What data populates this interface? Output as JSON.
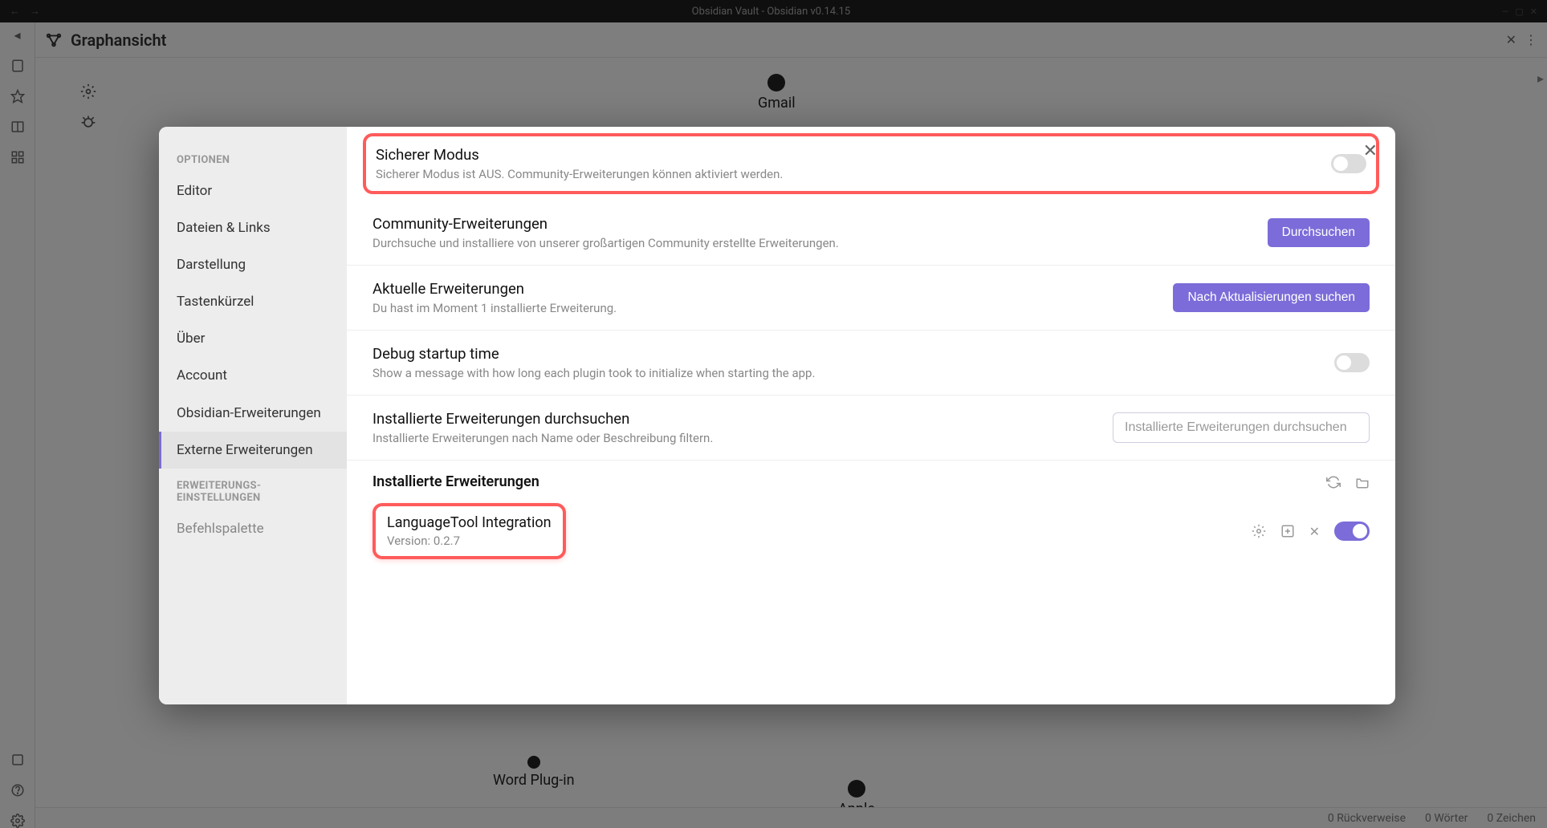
{
  "window": {
    "title": "Obsidian Vault - Obsidian v0.14.15"
  },
  "tab": {
    "title": "Graphansicht"
  },
  "graph": {
    "nodes": {
      "gmail": "Gmail",
      "wordplugin": "Word Plug-in",
      "apple": "Apple"
    }
  },
  "statusbar": {
    "backlinks": "0 Rückverweise",
    "words": "0 Wörter",
    "chars": "0 Zeichen"
  },
  "settings": {
    "sections": {
      "options": "OPTIONEN",
      "pluginSettings": "ERWEITERUNGS-EINSTELLUNGEN"
    },
    "items": {
      "editor": "Editor",
      "filesLinks": "Dateien & Links",
      "appearance": "Darstellung",
      "hotkeys": "Tastenkürzel",
      "about": "Über",
      "account": "Account",
      "corePlugins": "Obsidian-Erweiterungen",
      "communityPlugins": "Externe Erweiterungen",
      "befehlspalette": "Befehlspalette"
    },
    "safeMode": {
      "title": "Sicherer Modus",
      "desc": "Sicherer Modus ist AUS. Community-Erweiterungen können aktiviert werden."
    },
    "community": {
      "title": "Community-Erweiterungen",
      "desc": "Durchsuche und installiere von unserer großartigen Community erstellte Erweiterungen.",
      "button": "Durchsuchen"
    },
    "current": {
      "title": "Aktuelle Erweiterungen",
      "desc": "Du hast im Moment 1 installierte Erweiterung.",
      "button": "Nach Aktualisierungen suchen"
    },
    "debug": {
      "title": "Debug startup time",
      "desc": "Show a message with how long each plugin took to initialize when starting the app."
    },
    "search": {
      "title": "Installierte Erweiterungen durchsuchen",
      "desc": "Installierte Erweiterungen nach Name oder Beschreibung filtern.",
      "placeholder": "Installierte Erweiterungen durchsuchen"
    },
    "installed": {
      "heading": "Installierte Erweiterungen"
    },
    "plugin": {
      "name": "LanguageTool Integration",
      "version": "Version: 0.2.7"
    }
  }
}
